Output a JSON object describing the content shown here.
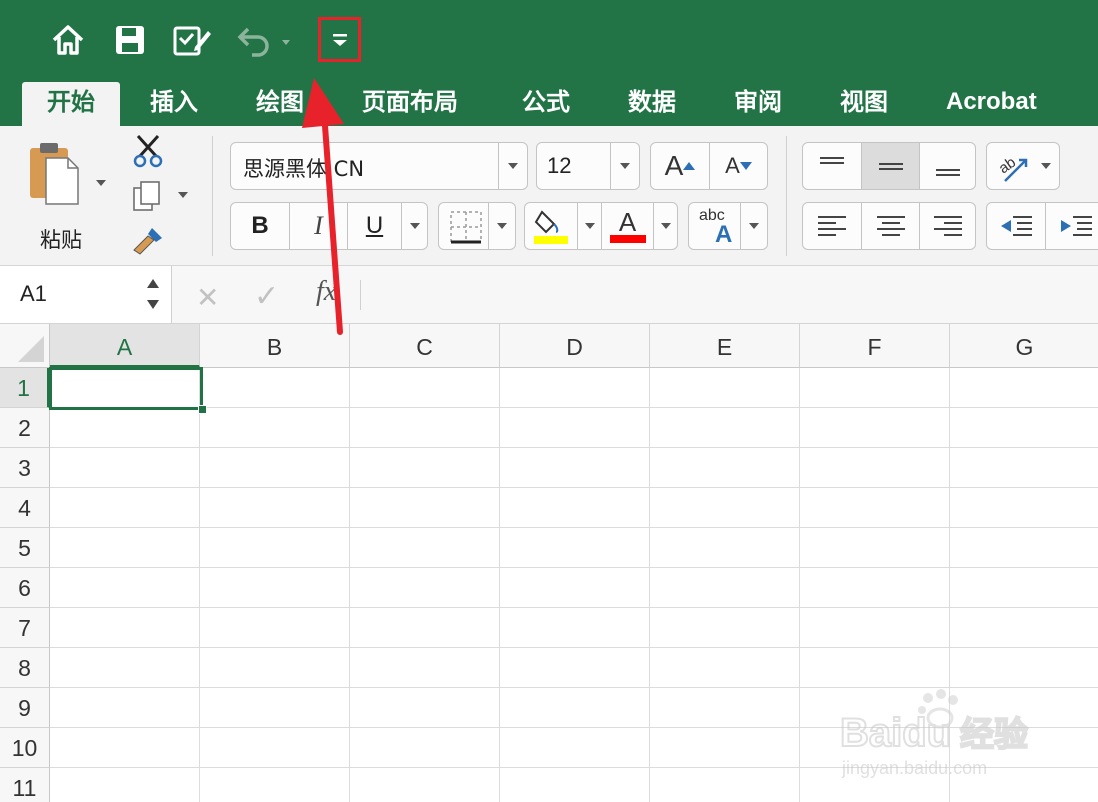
{
  "ribbon_tabs": [
    "开始",
    "插入",
    "绘图",
    "页面布局",
    "公式",
    "数据",
    "审阅",
    "视图",
    "Acrobat"
  ],
  "clipboard": {
    "paste_label": "粘贴"
  },
  "font": {
    "name": "思源黑体 CN",
    "size": "12"
  },
  "buttons": {
    "bold": "B",
    "italic": "I",
    "underline": "U",
    "font_color_letter": "A",
    "grow_font": "A",
    "shrink_font": "A",
    "phonetic_top": "abc",
    "phonetic_bottom": "A"
  },
  "formula_bar": {
    "name_box": "A1",
    "cancel": "✕",
    "enter": "✓",
    "fx": "fx"
  },
  "columns": [
    "A",
    "B",
    "C",
    "D",
    "E",
    "F",
    "G"
  ],
  "rows": [
    "1",
    "2",
    "3",
    "4",
    "5",
    "6",
    "7",
    "8",
    "9",
    "10",
    "11"
  ],
  "selected_cell": "A1",
  "colors": {
    "title_bar": "#227447",
    "accent_green": "#217346",
    "highlight_yellow": "#ffff00",
    "font_red": "#ff0000",
    "annotation_red": "#e8222b"
  },
  "watermark": {
    "brand": "Baidu",
    "suffix": "经验",
    "url": "jingyan.baidu.com"
  }
}
